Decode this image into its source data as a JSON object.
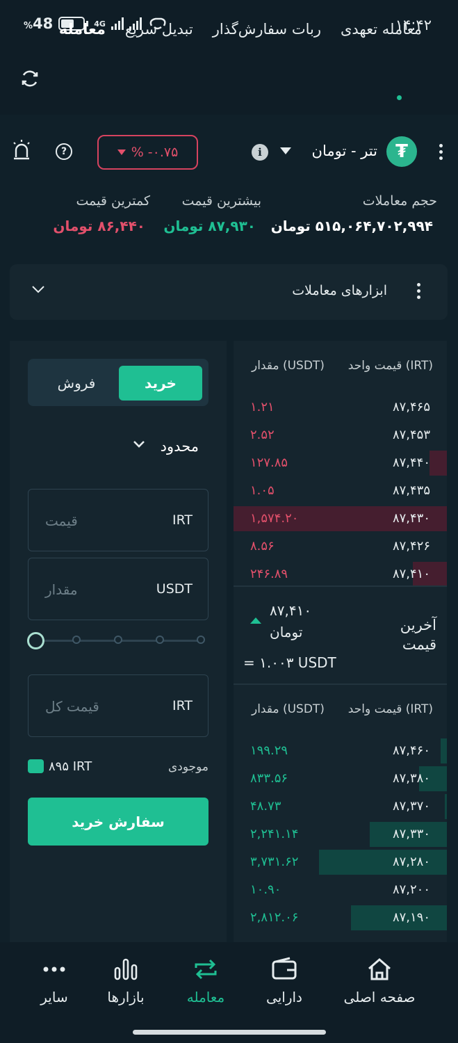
{
  "status": {
    "time": "۱۴:۴۲",
    "battery": "48",
    "percent_sign": "%",
    "network": "4G"
  },
  "topnav": {
    "items": [
      "معامله",
      "تبدیل سریع",
      "ربات سفارش‌گذار",
      "معامله تعهدی"
    ],
    "active": "معامله"
  },
  "pair": {
    "name": "تتر - تومان",
    "change": "% -۰.۷۵",
    "logo_glyph": "₮"
  },
  "stats": {
    "volume_label": "حجم معاملات",
    "volume_value": "۵۱۵,۰۶۴,۷۰۲,۹۹۴ تومان",
    "high_label": "بیشترین قیمت",
    "high_value": "۸۷,۹۳۰ تومان",
    "low_label": "کمترین قیمت",
    "low_value": "۸۶,۴۴۰ تومان"
  },
  "tools": {
    "label": "ابزارهای معاملات"
  },
  "order": {
    "buy_tab": "خرید",
    "sell_tab": "فروش",
    "type": "محدود",
    "price_unit": "IRT",
    "price_placeholder": "قیمت",
    "amount_unit": "USDT",
    "amount_placeholder": "مقدار",
    "total_unit": "IRT",
    "total_placeholder": "قیمت کل",
    "slider_percent": 0,
    "balance_label": "موجودی",
    "balance_value": "۸۹۵ IRT",
    "submit": "سفارش خرید"
  },
  "book": {
    "price_header": "قیمت واحد (IRT)",
    "qty_header": "مقدار (USDT)",
    "asks": [
      {
        "price": "۸۷,۴۶۵",
        "qty": "۱.۲۱",
        "depth": 0
      },
      {
        "price": "۸۷,۴۵۳",
        "qty": "۲.۵۲",
        "depth": 0
      },
      {
        "price": "۸۷,۴۴۰",
        "qty": "۱۲۷.۸۵",
        "depth": 0.08
      },
      {
        "price": "۸۷,۴۳۵",
        "qty": "۱.۰۵",
        "depth": 0
      },
      {
        "price": "۸۷,۴۳۰",
        "qty": "۱,۵۷۴.۲۰",
        "depth": 1.0
      },
      {
        "price": "۸۷,۴۲۶",
        "qty": "۸.۵۶",
        "depth": 0
      },
      {
        "price": "۸۷,۴۱۰",
        "qty": "۲۴۶.۸۹",
        "depth": 0.16
      }
    ],
    "last_label": "آخرین قیمت",
    "last_price": "۸۷,۴۱۰",
    "last_unit": "تومان",
    "last_usdt": "= ۱.۰۰۳ USDT",
    "bids": [
      {
        "price": "۸۷,۴۶۰",
        "qty": "۱۹۹.۲۹",
        "depth": 0.03
      },
      {
        "price": "۸۷,۳۸۰",
        "qty": "۸۳۳.۵۶",
        "depth": 0.13
      },
      {
        "price": "۸۷,۳۷۰",
        "qty": "۴۸.۷۳",
        "depth": 0.01
      },
      {
        "price": "۸۷,۳۳۰",
        "qty": "۲,۲۴۱.۱۴",
        "depth": 0.36
      },
      {
        "price": "۸۷,۲۸۰",
        "qty": "۳,۷۳۱.۶۲",
        "depth": 0.6
      },
      {
        "price": "۸۷,۲۰۰",
        "qty": "۱۰.۹۰",
        "depth": 0
      },
      {
        "price": "۸۷,۱۹۰",
        "qty": "۲,۸۱۲.۰۶",
        "depth": 0.45
      }
    ]
  },
  "bottom_nav": {
    "items": [
      "صفحه اصلی",
      "دارایی",
      "معامله",
      "بازارها",
      "سایر"
    ],
    "active": "معامله"
  },
  "colors": {
    "accent": "#1fbf93",
    "sell": "#e2506b",
    "background": "#102029",
    "panel": "#15252e"
  }
}
